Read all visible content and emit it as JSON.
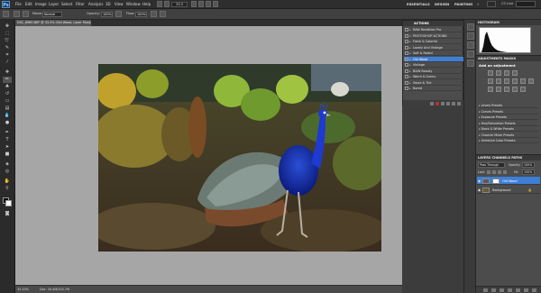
{
  "menubar": {
    "app_logo": "Ps",
    "items": [
      "File",
      "Edit",
      "Image",
      "Layer",
      "Select",
      "Filter",
      "Analysis",
      "3D",
      "View",
      "Window",
      "Help"
    ],
    "zoom": "33.3",
    "workspaces": [
      "ESSENTIALS",
      "DESIGN",
      "PAINTING"
    ],
    "workspace_more": "»",
    "cs_live": "CS Live"
  },
  "options": {
    "mode_label": "Mode:",
    "mode_value": "Normal",
    "opacity_label": "Opacity:",
    "opacity_value": "100%",
    "flow_label": "Flow:",
    "flow_value": "100%"
  },
  "document": {
    "tab_title": "DSC_6965.NEF @ 33.3% (Old Wood, Layer Mask/16)",
    "zoom_status": "33.33%",
    "doc_status": "Doc: 34.4M/102.7M"
  },
  "actions_panel": {
    "title": "ACTIONS",
    "rows": [
      {
        "label": "RAW Rendition Pro",
        "selected": false
      },
      {
        "label": "PHOTOSHOP ACTIONS",
        "selected": false
      },
      {
        "label": "Fresh & Colorful",
        "selected": false
      },
      {
        "label": "Lovely And Vintage",
        "selected": false
      },
      {
        "label": "Soft & Faded",
        "selected": false
      },
      {
        "label": "Old Wood",
        "selected": true
      },
      {
        "label": "Vintage",
        "selected": false
      },
      {
        "label": "B&W Beauty",
        "selected": false
      },
      {
        "label": "Warm & Sunny",
        "selected": false
      },
      {
        "label": "Sepia & Tint",
        "selected": false
      },
      {
        "label": "Bored",
        "selected": false
      }
    ]
  },
  "histogram": {
    "tab": "HISTOGRAM"
  },
  "adjustments": {
    "tabs": "ADJUSTMENTS  MASKS",
    "heading": "Add an adjustment",
    "presets": [
      "Levels Presets",
      "Curves Presets",
      "Exposure Presets",
      "Hue/Saturation Presets",
      "Black & White Presets",
      "Channel Mixer Presets",
      "Selective Color Presets"
    ]
  },
  "layers": {
    "tabs": "LAYERS  CHANNELS  PATHS",
    "blend_mode": "Pass Through",
    "opacity_label": "Opacity:",
    "opacity_value": "100%",
    "lock_label": "Lock:",
    "fill_label": "Fill:",
    "fill_value": "100%",
    "rows": [
      {
        "name": "Old Wood",
        "selected": true
      },
      {
        "name": "Background",
        "selected": false
      }
    ]
  },
  "colors": {
    "selection": "#3e7fd6",
    "canvas_bg": "#a6a6a6",
    "panel_bg": "#4c4c4c"
  }
}
